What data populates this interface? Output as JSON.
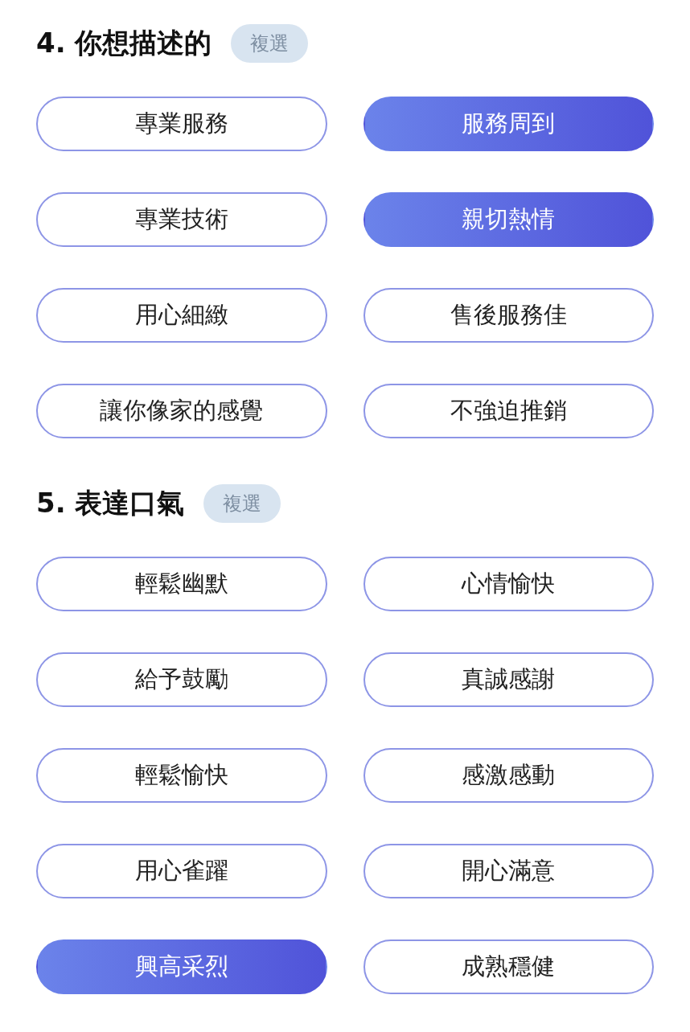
{
  "sections": [
    {
      "title": "4. 你想描述的",
      "badge": "複選",
      "options": [
        {
          "label": "專業服務",
          "selected": false
        },
        {
          "label": "服務周到",
          "selected": true
        },
        {
          "label": "專業技術",
          "selected": false
        },
        {
          "label": "親切熱情",
          "selected": true
        },
        {
          "label": "用心細緻",
          "selected": false
        },
        {
          "label": "售後服務佳",
          "selected": false
        },
        {
          "label": "讓你像家的感覺",
          "selected": false
        },
        {
          "label": "不強迫推銷",
          "selected": false
        }
      ]
    },
    {
      "title": "5. 表達口氣",
      "badge": "複選",
      "options": [
        {
          "label": "輕鬆幽默",
          "selected": false
        },
        {
          "label": "心情愉快",
          "selected": false
        },
        {
          "label": "給予鼓勵",
          "selected": false
        },
        {
          "label": "真誠感謝",
          "selected": false
        },
        {
          "label": "輕鬆愉快",
          "selected": false
        },
        {
          "label": "感激感動",
          "selected": false
        },
        {
          "label": "用心雀躍",
          "selected": false
        },
        {
          "label": "開心滿意",
          "selected": false
        },
        {
          "label": "興高采烈",
          "selected": true
        },
        {
          "label": "成熟穩健",
          "selected": false
        }
      ]
    }
  ]
}
